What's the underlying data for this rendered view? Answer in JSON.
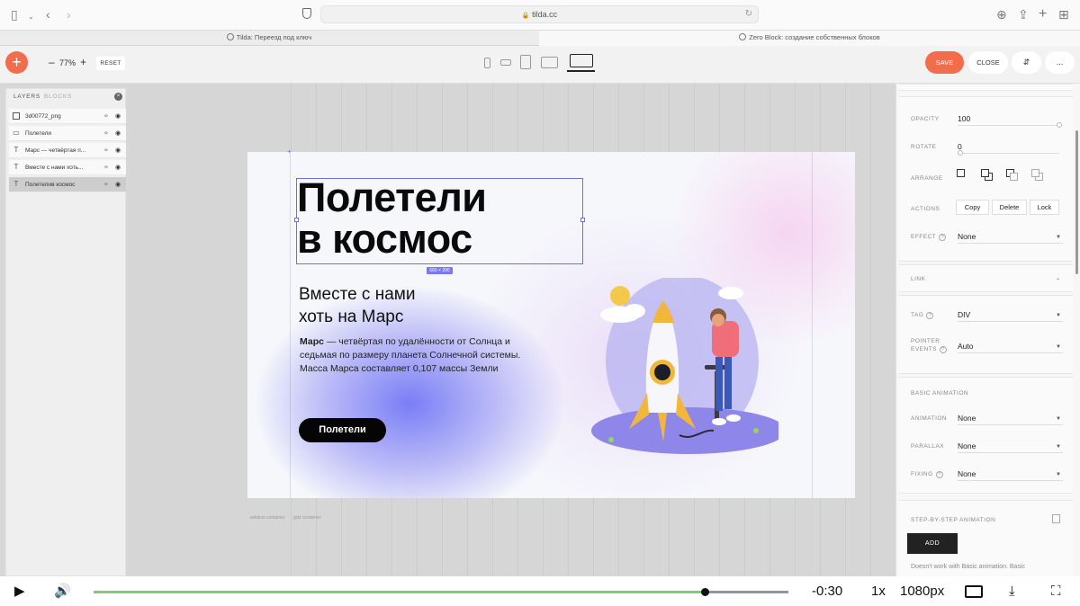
{
  "browser": {
    "url": "tilda.cc",
    "tabs": [
      {
        "label": "Tilda: Переезд под ключ",
        "active": false
      },
      {
        "label": "Zero Block: создание собственных блоков",
        "active": true
      }
    ]
  },
  "toolbar": {
    "add_label": "+",
    "zoom_minus": "–",
    "zoom_value": "77%",
    "zoom_plus": "+",
    "reset_label": "RESET",
    "save_label": "SAVE",
    "close_label": "CLOSE",
    "sort_label": "⇵",
    "more_label": "..."
  },
  "layers": {
    "tab_layers": "LAYERS",
    "tab_blocks": "BLOCKS",
    "items": [
      {
        "name": "3d00772_png",
        "icon": "image-icon",
        "selected": false
      },
      {
        "name": "Полетели",
        "icon": "button-icon",
        "selected": false
      },
      {
        "name": "Марс — четвёртая п...",
        "icon": "text-icon",
        "selected": false
      },
      {
        "name": "Вместе с нами хоть...",
        "icon": "text-icon",
        "selected": false
      },
      {
        "name": "Полетелив космос",
        "icon": "text-icon",
        "selected": true
      }
    ]
  },
  "artboard": {
    "headline_line1": "Полетели",
    "headline_line2": "в космос",
    "size_badge": "660 × 200",
    "subhead_line1": "Вместе с нами",
    "subhead_line2": "хоть на Марс",
    "body_bold": "Марс",
    "body_rest": " — четвёртая по удалённости от Солнца и седьмая по размеру планета Солнечной системы. Масса Марса составляет 0,107 массы Земли",
    "cta_label": "Полетели",
    "window_container": "window container",
    "grid_container": "grid container"
  },
  "properties": {
    "opacity_label": "OPACITY",
    "opacity_value": "100",
    "rotate_label": "ROTATE",
    "rotate_value": "0",
    "arrange_label": "ARRANGE",
    "actions_label": "ACTIONS",
    "actions": [
      "Copy",
      "Delete",
      "Lock"
    ],
    "effect_label": "EFFECT",
    "effect_value": "None",
    "link_label": "LINK",
    "tag_label": "TAG",
    "tag_value": "DIV",
    "pointer_label_1": "POINTER",
    "pointer_label_2": "EVENTS",
    "pointer_value": "Auto",
    "basic_anim_label": "BASIC ANIMATION",
    "animation_label": "ANIMATION",
    "animation_value": "None",
    "parallax_label": "PARALLAX",
    "parallax_value": "None",
    "fixing_label": "FIXING",
    "fixing_value": "None",
    "step_anim_label": "STEP-BY-STEP ANIMATION",
    "add_label": "ADD",
    "note": "Doesn't work with Basic animation. Basic"
  },
  "video": {
    "time_remaining": "-0:30",
    "speed": "1x",
    "quality": "1080px",
    "progress": 0.88
  },
  "colors": {
    "accent": "#f26d4c",
    "selection": "#6e6ee8",
    "progress": "#7bcf6e"
  }
}
